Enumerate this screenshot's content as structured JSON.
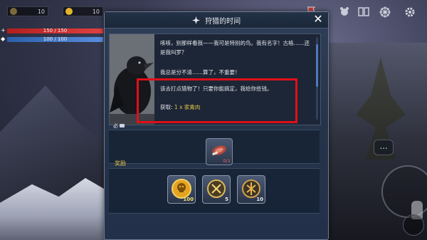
{
  "hud": {
    "level_value": "10",
    "gold_value": "10",
    "hp_text": "150 / 150",
    "mp_text": "100 / 100",
    "level_icon": "level-icon",
    "gold_icon": "gold-coin-icon"
  },
  "top_right_icons": [
    "flag-icon",
    "bear-icon",
    "book-icon",
    "ship-wheel-icon",
    "gear-icon"
  ],
  "dialog": {
    "title": "狩猎的时间",
    "close_label": "✕",
    "dialogue_line1": "咳咳，别那样看我——我可是特别的鸟。我有名字！古格……还是我叫罗？",
    "dialogue_line2": "我总是分不清……算了，不重要！",
    "dialogue_line3": "该去打点猎物了！只要你能搞定，我给你些钱。",
    "reward_label": "获取:",
    "reward_item": "1 x 家禽肉",
    "required_label": "必",
    "required_item": {
      "icon": "raw-meat-icon",
      "count_text": "0/1"
    },
    "rewards_title": "奖励",
    "rewards": [
      {
        "icon": "gold-skull-coin-icon",
        "count": "100"
      },
      {
        "icon": "xp-rune-icon",
        "count": "5"
      },
      {
        "icon": "rune-token-icon",
        "count": "10"
      }
    ]
  },
  "colors": {
    "highlight_border": "#e00f1a",
    "reward_text": "#e0c24a",
    "rewards_title": "#e9c84a",
    "hp": "#c62828",
    "mp": "#3f72c4"
  }
}
